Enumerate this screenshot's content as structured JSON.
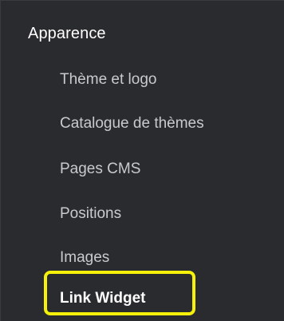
{
  "sidebar": {
    "section_title": "Apparence",
    "items": [
      {
        "label": "Thème et logo"
      },
      {
        "label": "Catalogue de thèmes"
      },
      {
        "label": "Pages CMS"
      },
      {
        "label": "Positions"
      },
      {
        "label": "Images"
      },
      {
        "label": "Link Widget",
        "active": true
      }
    ]
  },
  "colors": {
    "background": "#2a2b2e",
    "text_active": "#ffffff",
    "text_inactive": "#c9cacc",
    "highlight": "#f5f10a"
  }
}
